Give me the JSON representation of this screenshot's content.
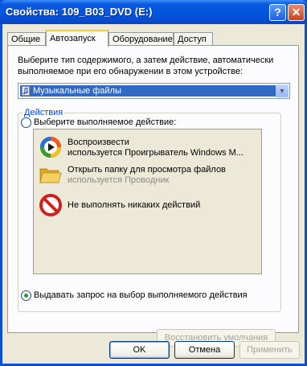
{
  "window": {
    "title": "Свойства: 109_B03_DVD (E:)",
    "help_label": "?",
    "close_label": "✕"
  },
  "tabs": [
    {
      "label": "Общие"
    },
    {
      "label": "Автозапуск"
    },
    {
      "label": "Оборудование"
    },
    {
      "label": "Доступ"
    }
  ],
  "autoplay": {
    "instruction": "Выберите тип содержимого, а затем действие, автоматически выполняемое при его обнаружении в этом устройстве:",
    "content_type_selected": "Музыкальные файлы",
    "actions_group_label": "Действия",
    "radio_choose_label": "Выберите выполняемое действие:",
    "radio_prompt_label": "Выдавать запрос на выбор выполняемого действия",
    "actions": [
      {
        "line1": "Воспроизвести",
        "line2": "используется Проигрыватель Windows M...",
        "icon": "windows-media-player-icon"
      },
      {
        "line1": "Открыть папку для просмотра файлов",
        "line2": "используется Проводник",
        "icon": "folder-icon"
      },
      {
        "line1": "Не выполнять никаких действий",
        "line2": "",
        "icon": "no-action-icon"
      }
    ],
    "restore_defaults_label": "Восстановить умолчания"
  },
  "buttons": {
    "ok": "OK",
    "cancel": "Отмена",
    "apply": "Применить"
  },
  "colors": {
    "titlebar": "#0453dc",
    "dialog_bg": "#ece9d8",
    "selection": "#316ac5",
    "radio_dot": "#21a121",
    "group_label": "#0046d5"
  }
}
